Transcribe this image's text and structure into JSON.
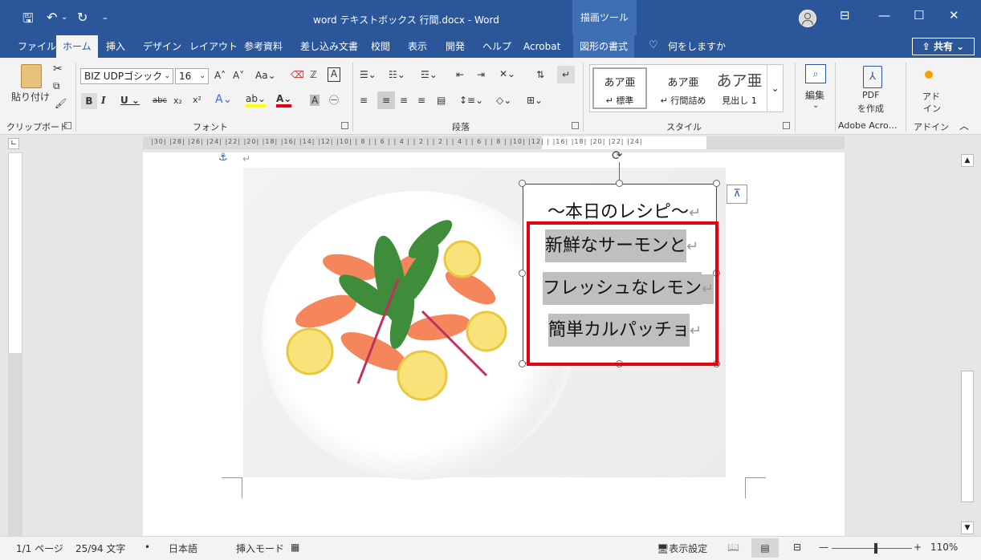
{
  "titlebar": {
    "doc_title": "word テキストボックス 行間.docx  -  Word",
    "drawing_tools": "描画ツール",
    "undo_icon": "↶",
    "redo_icon": "↻",
    "save_icon": "🖫"
  },
  "tabs": [
    "ファイル",
    "ホーム",
    "挿入",
    "デザイン",
    "レイアウト",
    "参考資料",
    "差し込み文書",
    "校閲",
    "表示",
    "開発",
    "ヘルプ",
    "Acrobat",
    "図形の書式"
  ],
  "search_placeholder": "何をしますか",
  "share_label": "共有",
  "ribbon": {
    "paste_label": "貼り付け",
    "clipboard_label": "クリップボード",
    "font_name": "BIZ UDPゴシック",
    "font_size": "16",
    "font_label": "フォント",
    "paragraph_label": "段落",
    "styles": [
      {
        "sample": "あア亜",
        "name": "標準"
      },
      {
        "sample": "あア亜",
        "name": "行間詰め"
      },
      {
        "sample": "あア亜",
        "name": "見出し 1"
      }
    ],
    "styles_label": "スタイル",
    "edit_label": "編集",
    "pdf_label1": "PDF",
    "pdf_label2": "を作成",
    "adobe_label": "Adobe Acro…",
    "addin_label1": "アド",
    "addin_label2": "イン",
    "addin_group_label": "アドイン"
  },
  "ruler_ticks": "|30| |28| |26| |24| |22| |20| |18| |16| |14| |12| |10| | 8 | | 6 | | 4 | | 2 |    | 2 | | 4 | | 6 | | 8 | |10| |12| |   |16| |18| |20| |22| |24|",
  "textbox": {
    "title": "～本日のレシピ～",
    "lines": [
      "新鮮なサーモンと",
      "フレッシュなレモン",
      "簡単カルパッチョ"
    ]
  },
  "statusbar": {
    "page": "1/1 ページ",
    "words": "25/94 文字",
    "language": "日本語",
    "mode": "挿入モード",
    "display_settings": "表示設定",
    "zoom": "110%",
    "zoom_level": 0.55
  },
  "colors": {
    "accent": "#2b579a",
    "highlight": "#bfbfbf",
    "red_frame": "#e60012"
  }
}
